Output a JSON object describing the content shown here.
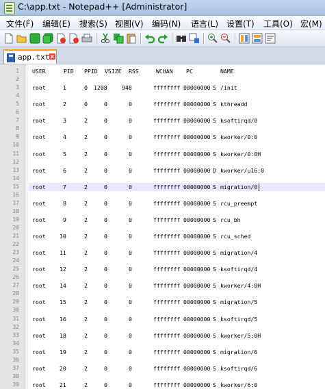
{
  "window": {
    "title": "C:\\app.txt - Notepad++ [Administrator]"
  },
  "menu": [
    "文件(F)",
    "编辑(E)",
    "搜索(S)",
    "视图(V)",
    "编码(N)",
    "语言(L)",
    "设置(T)",
    "工具(O)",
    "宏(M)"
  ],
  "toolbar": {
    "icons": [
      "new-file-icon",
      "open-file-icon",
      "save-icon",
      "save-all-icon",
      "close-icon",
      "close-all-icon",
      "print-icon",
      "cut-icon",
      "copy-icon",
      "paste-icon",
      "undo-icon",
      "redo-icon",
      "find-icon",
      "replace-icon",
      "zoom-in-icon",
      "zoom-out-icon",
      "sync-vertical-icon",
      "sync-horizontal-icon",
      "word-wrap-icon"
    ]
  },
  "tab": {
    "label": "app.txt",
    "close": "x"
  },
  "editor": {
    "header": {
      "user": "USER",
      "pid": "PID",
      "ppid": "PPID",
      "vsize": "VSIZE",
      "rss": "RSS",
      "wchan": "WCHAN",
      "pc": "PC",
      "name": "NAME"
    },
    "processes": [
      {
        "user": "root",
        "pid": "1",
        "ppid": "0",
        "vsize": "1208",
        "rss": "948",
        "wchan": "ffffffff",
        "pc": "00000000",
        "s": "S",
        "name": "/init"
      },
      {
        "user": "root",
        "pid": "2",
        "ppid": "0",
        "vsize": "0",
        "rss": "0",
        "wchan": "ffffffff",
        "pc": "00000000",
        "s": "S",
        "name": "kthreadd"
      },
      {
        "user": "root",
        "pid": "3",
        "ppid": "2",
        "vsize": "0",
        "rss": "0",
        "wchan": "ffffffff",
        "pc": "00000000",
        "s": "S",
        "name": "ksoftirqd/0"
      },
      {
        "user": "root",
        "pid": "4",
        "ppid": "2",
        "vsize": "0",
        "rss": "0",
        "wchan": "ffffffff",
        "pc": "00000000",
        "s": "S",
        "name": "kworker/0:0"
      },
      {
        "user": "root",
        "pid": "5",
        "ppid": "2",
        "vsize": "0",
        "rss": "0",
        "wchan": "ffffffff",
        "pc": "00000000",
        "s": "S",
        "name": "kworker/0:0H"
      },
      {
        "user": "root",
        "pid": "6",
        "ppid": "2",
        "vsize": "0",
        "rss": "0",
        "wchan": "ffffffff",
        "pc": "00000000",
        "s": "D",
        "name": "kworker/u16:0"
      },
      {
        "user": "root",
        "pid": "7",
        "ppid": "2",
        "vsize": "0",
        "rss": "0",
        "wchan": "ffffffff",
        "pc": "00000000",
        "s": "S",
        "name": "migration/0"
      },
      {
        "user": "root",
        "pid": "8",
        "ppid": "2",
        "vsize": "0",
        "rss": "0",
        "wchan": "ffffffff",
        "pc": "00000000",
        "s": "S",
        "name": "rcu_preempt"
      },
      {
        "user": "root",
        "pid": "9",
        "ppid": "2",
        "vsize": "0",
        "rss": "0",
        "wchan": "ffffffff",
        "pc": "00000000",
        "s": "S",
        "name": "rcu_bh"
      },
      {
        "user": "root",
        "pid": "10",
        "ppid": "2",
        "vsize": "0",
        "rss": "0",
        "wchan": "ffffffff",
        "pc": "00000000",
        "s": "S",
        "name": "rcu_sched"
      },
      {
        "user": "root",
        "pid": "11",
        "ppid": "2",
        "vsize": "0",
        "rss": "0",
        "wchan": "ffffffff",
        "pc": "00000000",
        "s": "S",
        "name": "migration/4"
      },
      {
        "user": "root",
        "pid": "12",
        "ppid": "2",
        "vsize": "0",
        "rss": "0",
        "wchan": "ffffffff",
        "pc": "00000000",
        "s": "S",
        "name": "ksoftirqd/4"
      },
      {
        "user": "root",
        "pid": "14",
        "ppid": "2",
        "vsize": "0",
        "rss": "0",
        "wchan": "ffffffff",
        "pc": "00000000",
        "s": "S",
        "name": "kworker/4:0H"
      },
      {
        "user": "root",
        "pid": "15",
        "ppid": "2",
        "vsize": "0",
        "rss": "0",
        "wchan": "ffffffff",
        "pc": "00000000",
        "s": "S",
        "name": "migration/5"
      },
      {
        "user": "root",
        "pid": "16",
        "ppid": "2",
        "vsize": "0",
        "rss": "0",
        "wchan": "ffffffff",
        "pc": "00000000",
        "s": "S",
        "name": "ksoftirqd/5"
      },
      {
        "user": "root",
        "pid": "18",
        "ppid": "2",
        "vsize": "0",
        "rss": "0",
        "wchan": "ffffffff",
        "pc": "00000000",
        "s": "S",
        "name": "kworker/5:0H"
      },
      {
        "user": "root",
        "pid": "19",
        "ppid": "2",
        "vsize": "0",
        "rss": "0",
        "wchan": "ffffffff",
        "pc": "00000000",
        "s": "S",
        "name": "migration/6"
      },
      {
        "user": "root",
        "pid": "20",
        "ppid": "2",
        "vsize": "0",
        "rss": "0",
        "wchan": "ffffffff",
        "pc": "00000000",
        "s": "S",
        "name": "ksoftirqd/6"
      },
      {
        "user": "root",
        "pid": "21",
        "ppid": "2",
        "vsize": "0",
        "rss": "0",
        "wchan": "ffffffff",
        "pc": "00000000",
        "s": "S",
        "name": "kworker/6:0"
      }
    ],
    "line_numbers": [
      "1",
      "2",
      "3",
      "4",
      "5",
      "6",
      "7",
      "8",
      "9",
      "10",
      "11",
      "12",
      "13",
      "14",
      "15",
      "16",
      "17",
      "18",
      "19",
      "20",
      "21",
      "22",
      "23",
      "24",
      "25",
      "26",
      "27",
      "28",
      "29",
      "30",
      "31",
      "32",
      "33",
      "34",
      "35",
      "36",
      "37",
      "38",
      "39"
    ],
    "current_line": "15"
  },
  "colors": {
    "current_line": "#e8e8ff",
    "gutter": "#e4e4e4",
    "tab_accent": "#f7a600"
  }
}
